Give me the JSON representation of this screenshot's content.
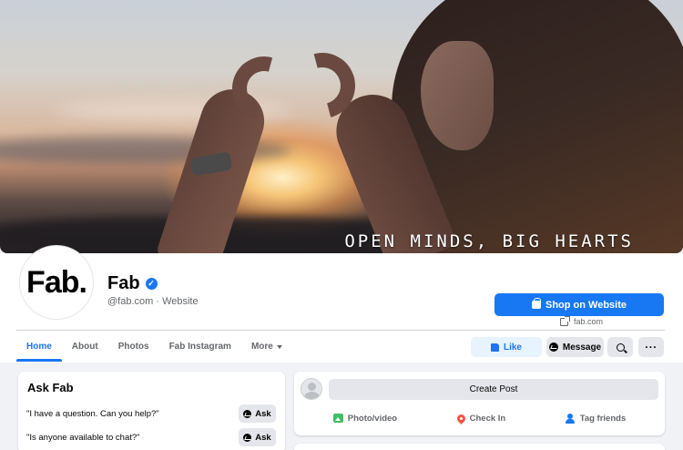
{
  "cover": {
    "slogan": "OPEN MINDS, BIG HEARTS"
  },
  "profile": {
    "logo_text": "Fab.",
    "name": "Fab",
    "verified_mark": "✓",
    "subtitle": "@fab.com · Website"
  },
  "header_actions": {
    "shop_label": "Shop on Website",
    "website_link": "fab.com"
  },
  "tabs": [
    {
      "label": "Home",
      "active": true
    },
    {
      "label": "About"
    },
    {
      "label": "Photos"
    },
    {
      "label": "Fab Instagram"
    },
    {
      "label": "More"
    }
  ],
  "action_buttons": {
    "like_label": "Like",
    "message_label": "Message",
    "more_label": "···"
  },
  "ask": {
    "title": "Ask Fab",
    "questions": [
      {
        "text": "\"I have a question. Can you help?\"",
        "button": "Ask"
      },
      {
        "text": "\"Is anyone available to chat?\"",
        "button": "Ask"
      }
    ]
  },
  "composer": {
    "create_label": "Create Post",
    "actions": [
      {
        "label": "Photo/video",
        "icon": "photo-video-icon"
      },
      {
        "label": "Check In",
        "icon": "location-pin-icon"
      },
      {
        "label": "Tag friends",
        "icon": "tag-friends-icon"
      }
    ]
  },
  "colors": {
    "brand_blue": "#1877f2",
    "like_bg": "#e7f3ff",
    "page_bg": "#f0f2f5"
  }
}
